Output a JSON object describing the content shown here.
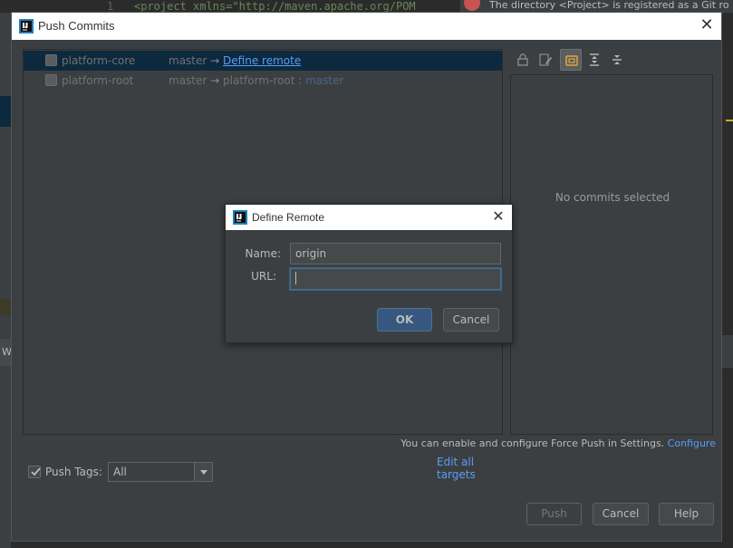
{
  "background": {
    "editor_line_number": "1",
    "editor_code": "<project xmlns=\"http://maven.apache.org/POM",
    "notification_text": "The directory <Project> is registered as a Git ro",
    "left_tab_letter": "W"
  },
  "dialog": {
    "title": "Push Commits",
    "repos": [
      {
        "name": "platform-core",
        "branch": "master",
        "arrow": "→",
        "target": "Define remote",
        "selected": true
      },
      {
        "name": "platform-root",
        "branch": "master",
        "arrow": "→",
        "target": "platform-root",
        "separator": ":",
        "remote_branch": "master",
        "selected": false
      }
    ],
    "edit_all_targets": "Edit all targets",
    "no_commits": "No commits selected",
    "force_push_hint": "You can enable and configure Force Push in Settings.",
    "configure_link": "Configure",
    "push_tags": {
      "checked": true,
      "label": "Push Tags:",
      "value": "All"
    },
    "buttons": {
      "push": "Push",
      "cancel": "Cancel",
      "help": "Help"
    },
    "toolbar_icons": [
      "lock-icon",
      "edit-icon",
      "changes-icon",
      "expand-all-icon",
      "collapse-all-icon"
    ]
  },
  "define_remote": {
    "title": "Define Remote",
    "name_label": "Name:",
    "name_value": "origin",
    "url_label": "URL:",
    "url_value": "",
    "ok_label": "OK",
    "cancel_label": "Cancel"
  },
  "colors": {
    "link": "#589df6",
    "selection": "#0d293e",
    "panel": "#3c3f41",
    "default_button": "#365880"
  }
}
